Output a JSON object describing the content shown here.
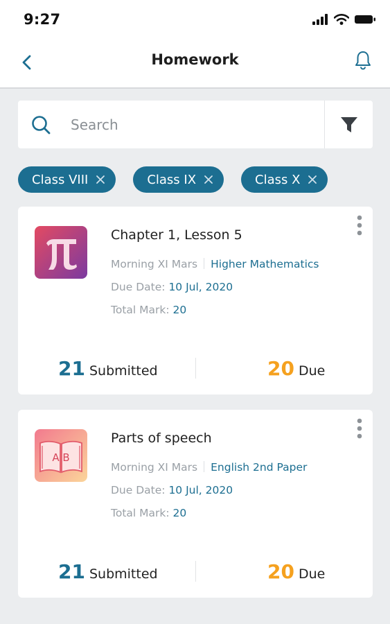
{
  "status_bar": {
    "time": "9:27"
  },
  "header": {
    "title": "Homework",
    "back_icon": "chevron-left-icon",
    "bell_icon": "bell-icon"
  },
  "search": {
    "placeholder": "Search",
    "value": "",
    "filter_icon": "filter-icon"
  },
  "filters": [
    {
      "label": "Class VIII"
    },
    {
      "label": "Class IX"
    },
    {
      "label": "Class X"
    }
  ],
  "homework": [
    {
      "title": "Chapter 1, Lesson 5",
      "section": "Morning XI Mars",
      "subject": "Higher Mathematics",
      "due_label": "Due Date:",
      "due_date": "10 Jul, 2020",
      "mark_label": "Total Mark:",
      "total_mark": "20",
      "submitted_count": "21",
      "submitted_label": "Submitted",
      "due_count": "20",
      "due_count_label": "Due",
      "icon": "pi-icon"
    },
    {
      "title": "Parts of speech",
      "section": "Morning XI Mars",
      "subject": "English 2nd Paper",
      "due_label": "Due Date:",
      "due_date": "10 Jul, 2020",
      "mark_label": "Total Mark:",
      "total_mark": "20",
      "submitted_count": "21",
      "submitted_label": "Submitted",
      "due_count": "20",
      "due_count_label": "Due",
      "icon": "ab-book-icon",
      "icon_text": "A B"
    }
  ],
  "colors": {
    "accent": "#1c6e91",
    "due": "#f5a11f",
    "background": "#ebedef"
  }
}
